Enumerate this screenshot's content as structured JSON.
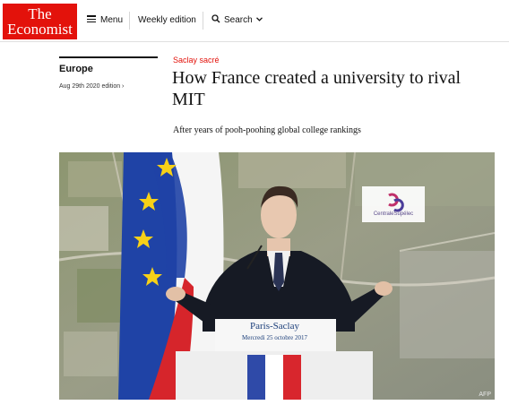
{
  "header": {
    "logo_line1": "The",
    "logo_line2": "Economist",
    "menu_label": "Menu",
    "weekly_label": "Weekly edition",
    "search_label": "Search",
    "brand_color": "#e3120b"
  },
  "section": {
    "name": "Europe",
    "edition": "Aug 29th 2020 edition ›"
  },
  "article": {
    "kicker": "Saclay sacré",
    "headline": "How France created a university to rival MIT",
    "standfirst": "After years of pooh-poohing global college rankings"
  },
  "photo": {
    "sign_title": "Paris-Saclay",
    "sign_date": "Mercredi 25 octobre 2017",
    "school_label": "CentraleSupélec",
    "credit": "AFP"
  },
  "icons": {
    "menu": "hamburger-icon",
    "search": "search-icon",
    "chevron": "chevron-down-icon"
  }
}
